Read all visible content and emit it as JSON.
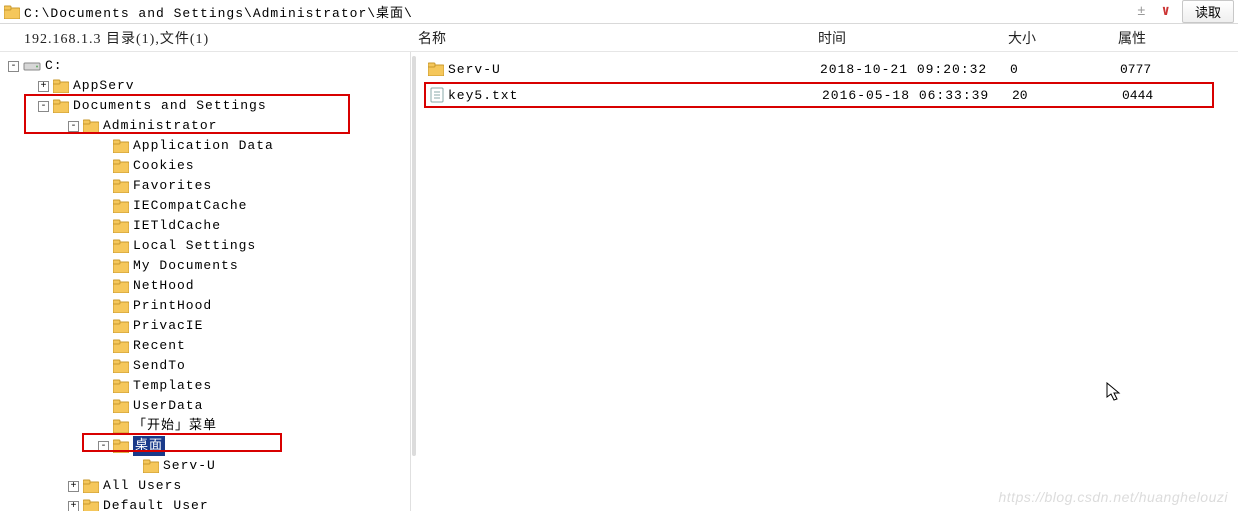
{
  "titlebar": {
    "path": "C:\\Documents and Settings\\Administrator\\桌面\\",
    "pin_symbol": "±",
    "caret_symbol": "∨",
    "read_button": "读取"
  },
  "statusbar": {
    "ip_and_counts": "192.168.1.3      目录(1),文件(1)",
    "col_name": "名称",
    "col_time": "时间",
    "col_size": "大小",
    "col_attr": "属性"
  },
  "tree": {
    "root": "C:",
    "items": [
      {
        "indent": 1,
        "exp": "+",
        "label": "AppServ"
      },
      {
        "indent": 1,
        "exp": "-",
        "label": "Documents and Settings"
      },
      {
        "indent": 2,
        "exp": "-",
        "label": "Administrator"
      },
      {
        "indent": 3,
        "exp": "",
        "label": "Application Data"
      },
      {
        "indent": 3,
        "exp": "",
        "label": "Cookies"
      },
      {
        "indent": 3,
        "exp": "",
        "label": "Favorites"
      },
      {
        "indent": 3,
        "exp": "",
        "label": "IECompatCache"
      },
      {
        "indent": 3,
        "exp": "",
        "label": "IETldCache"
      },
      {
        "indent": 3,
        "exp": "",
        "label": "Local Settings"
      },
      {
        "indent": 3,
        "exp": "",
        "label": "My Documents"
      },
      {
        "indent": 3,
        "exp": "",
        "label": "NetHood"
      },
      {
        "indent": 3,
        "exp": "",
        "label": "PrintHood"
      },
      {
        "indent": 3,
        "exp": "",
        "label": "PrivacIE"
      },
      {
        "indent": 3,
        "exp": "",
        "label": "Recent"
      },
      {
        "indent": 3,
        "exp": "",
        "label": "SendTo"
      },
      {
        "indent": 3,
        "exp": "",
        "label": "Templates"
      },
      {
        "indent": 3,
        "exp": "",
        "label": "UserData"
      },
      {
        "indent": 3,
        "exp": "",
        "label": "「开始」菜单"
      },
      {
        "indent": 3,
        "exp": "-",
        "label": "桌面",
        "selected": true
      },
      {
        "indent": 4,
        "exp": "",
        "label": "Serv-U"
      },
      {
        "indent": 2,
        "exp": "+",
        "label": "All Users"
      },
      {
        "indent": 2,
        "exp": "+",
        "label": "Default User"
      }
    ]
  },
  "files": [
    {
      "icon": "folder",
      "name": "Serv-U",
      "time": "2018-10-21 09:20:32",
      "size": "0",
      "attr": "0777",
      "hl": false
    },
    {
      "icon": "file",
      "name": "key5.txt",
      "time": "2016-05-18 06:33:39",
      "size": "20",
      "attr": "0444",
      "hl": true
    }
  ],
  "watermark": "https://blog.csdn.net/huanghelouzi"
}
